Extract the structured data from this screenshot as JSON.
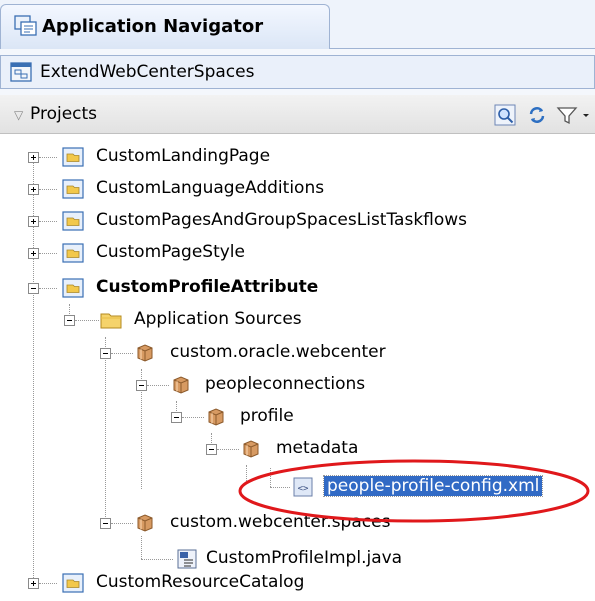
{
  "window": {
    "title": "Application Navigator"
  },
  "application": {
    "name": "ExtendWebCenterSpaces"
  },
  "projects_panel": {
    "label": "Projects"
  },
  "tree": {
    "custom_landing_page": "CustomLandingPage",
    "custom_language_additions": "CustomLanguageAdditions",
    "custom_pages_lists": "CustomPagesAndGroupSpacesListTaskflows",
    "custom_page_style": "CustomPageStyle",
    "custom_profile_attribute": "CustomProfileAttribute",
    "application_sources": "Application Sources",
    "pkg_custom_oracle_webcenter": "custom.oracle.webcenter",
    "pkg_peopleconnections": "peopleconnections",
    "pkg_profile": "profile",
    "pkg_metadata": "metadata",
    "file_people_profile_config": "people-profile-config.xml",
    "pkg_custom_webcenter_spaces": "custom.webcenter.spaces",
    "file_custom_profile_impl": "CustomProfileImpl.java",
    "custom_resource_catalog": "CustomResourceCatalog"
  },
  "colors": {
    "selection": "#316ac5",
    "annotation": "#e0181b",
    "folder": "#f2c84b",
    "package": "#c8844a"
  },
  "icons": [
    "navigator-icon",
    "application-icon",
    "search-icon",
    "refresh-icon",
    "filter-icon",
    "project-folder-icon",
    "folder-icon",
    "package-icon",
    "xml-file-icon",
    "java-file-icon"
  ]
}
